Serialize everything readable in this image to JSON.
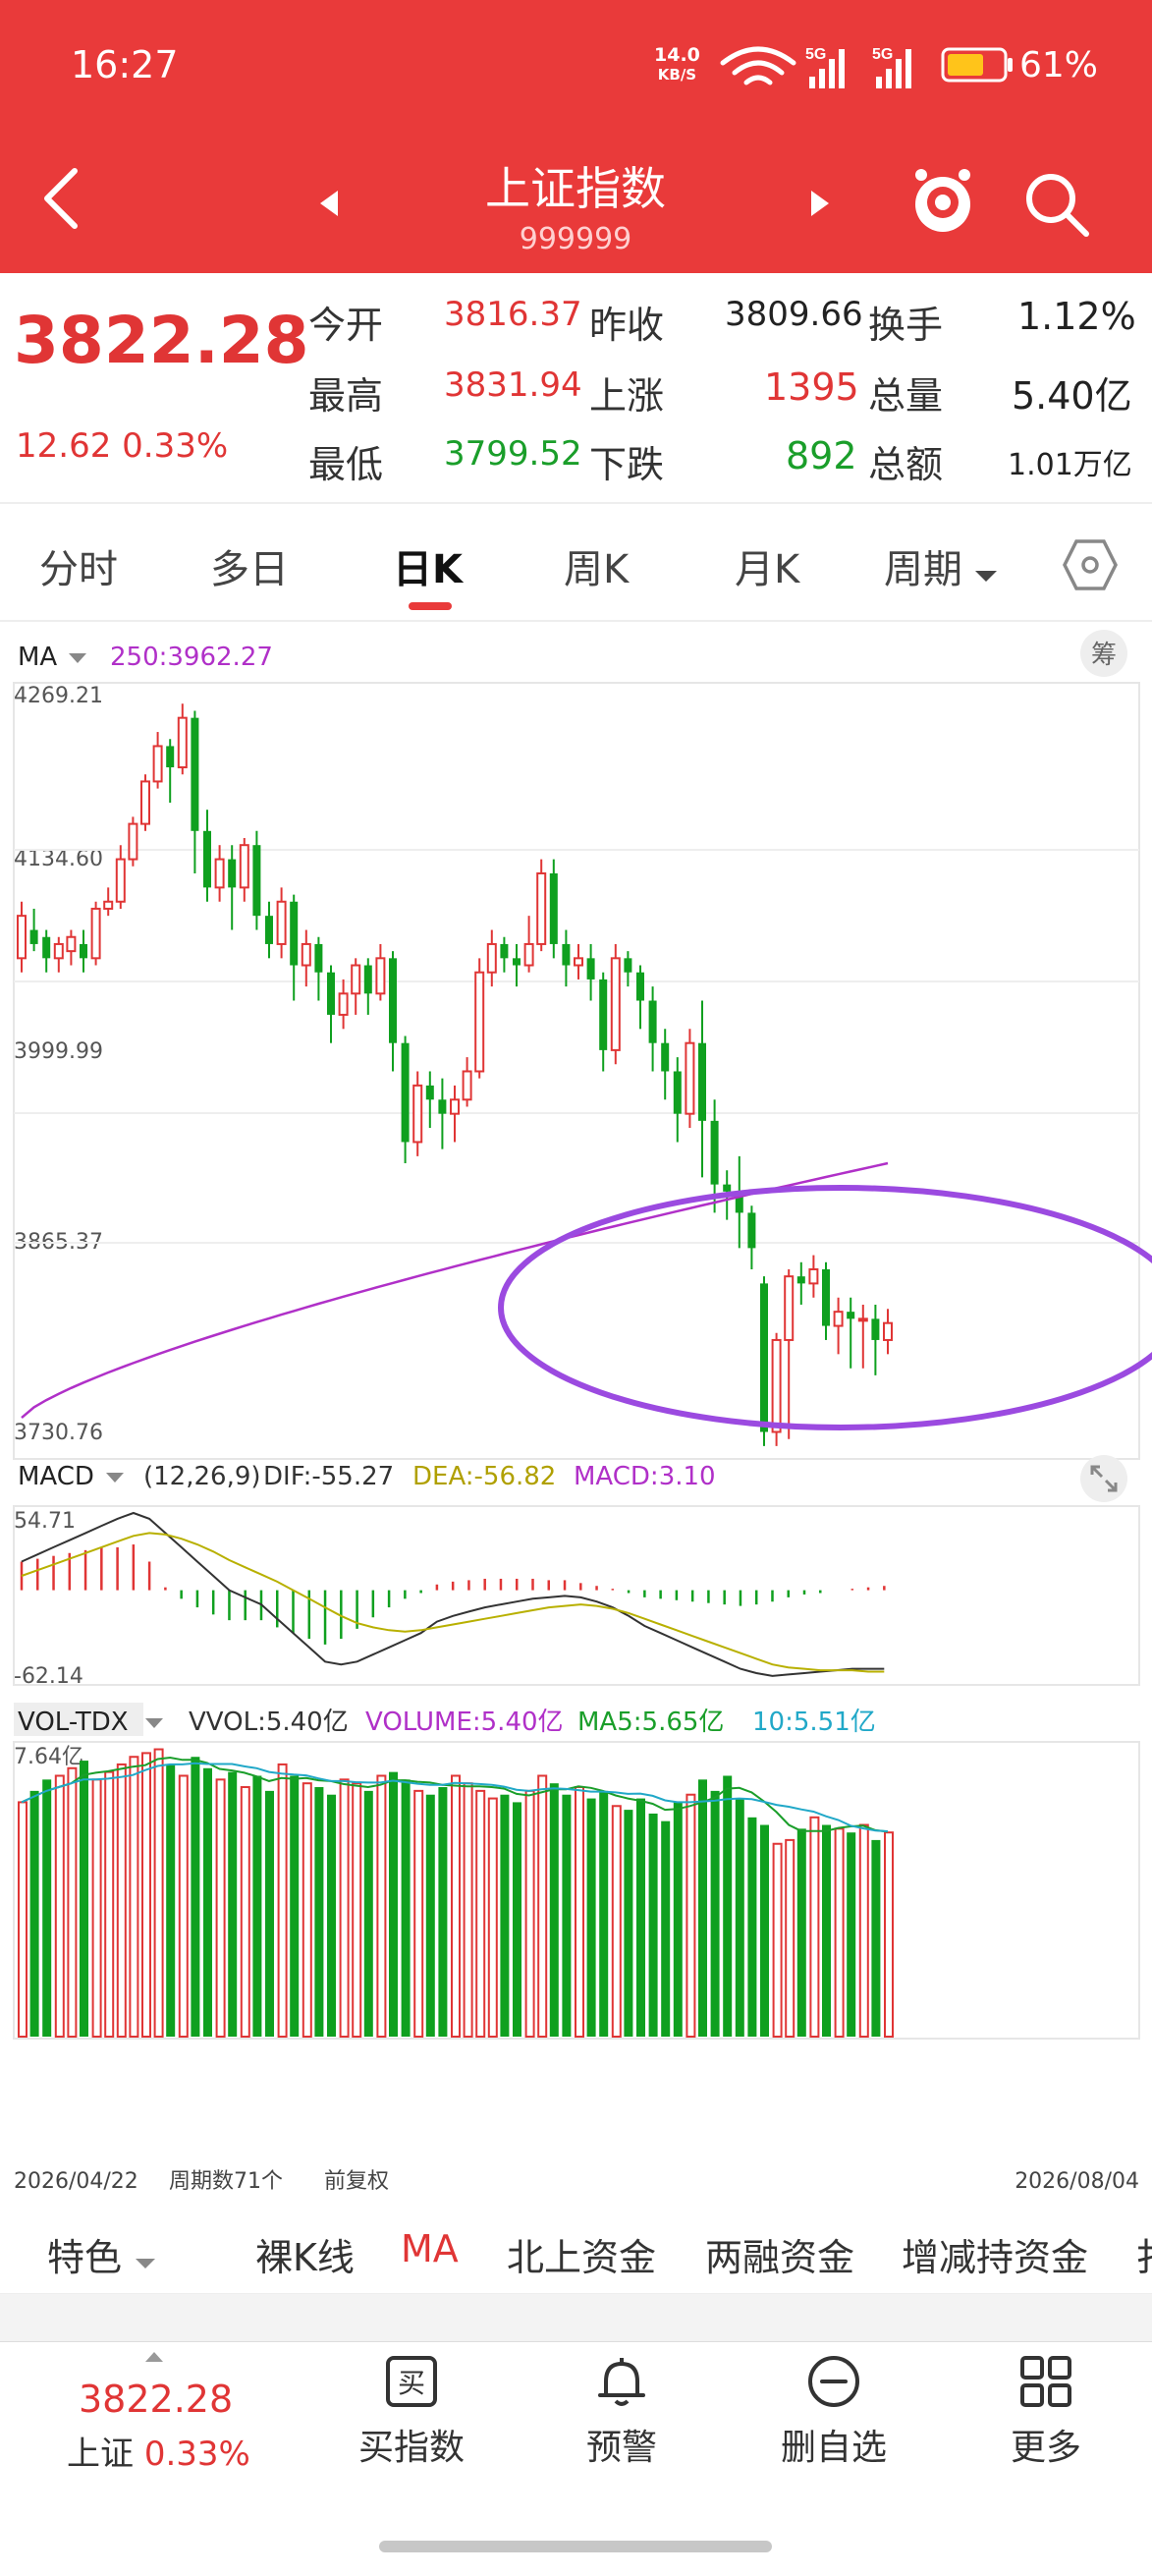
{
  "status": {
    "time": "16:27",
    "speed": "14.0",
    "speed_unit": "KB/S",
    "battery": "61%"
  },
  "header": {
    "title": "上证指数",
    "code": "999999"
  },
  "quote": {
    "price": "3822.28",
    "change": "12.62",
    "change_pct": "0.33%",
    "rows": [
      [
        {
          "label": "今开",
          "value": "3816.37",
          "color": "red"
        },
        {
          "label": "昨收",
          "value": "3809.66",
          "color": "black"
        },
        {
          "label": "换手",
          "value": "1.12%",
          "color": "black"
        }
      ],
      [
        {
          "label": "最高",
          "value": "3831.94",
          "color": "red"
        },
        {
          "label": "上涨",
          "value": "1395",
          "color": "red"
        },
        {
          "label": "总量",
          "value": "5.40亿",
          "color": "black"
        }
      ],
      [
        {
          "label": "最低",
          "value": "3799.52",
          "color": "green"
        },
        {
          "label": "下跌",
          "value": "892",
          "color": "green"
        },
        {
          "label": "总额",
          "value": "1.01万亿",
          "color": "black"
        }
      ]
    ]
  },
  "tabs": {
    "intraday": "分时",
    "multiday": "多日",
    "dayk": "日K",
    "weekk": "周K",
    "monthk": "月K",
    "period": "周期"
  },
  "main_chart": {
    "indicator": "MA",
    "ma_label": "250:3962.27",
    "chip_label": "筹",
    "y_ticks": [
      "4269.21",
      "4134.60",
      "3999.99",
      "3865.37",
      "3730.76"
    ]
  },
  "macd": {
    "indicator": "MACD",
    "params": "(12,26,9)",
    "dif": "DIF:-55.27",
    "dea": "DEA:-56.82",
    "macd": "MACD:3.10",
    "top": "54.71",
    "bottom": "-62.14"
  },
  "vol": {
    "indicator": "VOL-TDX",
    "vvol": "VVOL:5.40亿",
    "volume": "VOLUME:5.40亿",
    "ma5": "MA5:5.65亿",
    "ma10": "10:5.51亿",
    "top": "7.64亿"
  },
  "x_axis": {
    "start": "2026/04/22",
    "count": "周期数71个",
    "adjust": "前复权",
    "end": "2026/08/04"
  },
  "chart_data": {
    "type": "candlestick",
    "y_range": [
      3730.76,
      4269.21
    ],
    "ma250": {
      "name": "250",
      "start": 3755,
      "end": 3935
    },
    "candles": [
      [
        4080,
        4110,
        4120,
        4070
      ],
      [
        4100,
        4090,
        4115,
        4085
      ],
      [
        4095,
        4080,
        4100,
        4070
      ],
      [
        4080,
        4090,
        4095,
        4070
      ],
      [
        4085,
        4095,
        4100,
        4075
      ],
      [
        4090,
        4080,
        4100,
        4070
      ],
      [
        4080,
        4115,
        4120,
        4075
      ],
      [
        4115,
        4120,
        4130,
        4110
      ],
      [
        4120,
        4150,
        4160,
        4115
      ],
      [
        4150,
        4175,
        4180,
        4145
      ],
      [
        4175,
        4205,
        4210,
        4170
      ],
      [
        4205,
        4230,
        4240,
        4200
      ],
      [
        4230,
        4215,
        4235,
        4190
      ],
      [
        4215,
        4250,
        4260,
        4210
      ],
      [
        4250,
        4170,
        4255,
        4140
      ],
      [
        4170,
        4130,
        4185,
        4120
      ],
      [
        4130,
        4150,
        4160,
        4120
      ],
      [
        4150,
        4130,
        4160,
        4100
      ],
      [
        4130,
        4160,
        4165,
        4120
      ],
      [
        4160,
        4110,
        4170,
        4100
      ],
      [
        4110,
        4090,
        4120,
        4080
      ],
      [
        4090,
        4120,
        4130,
        4080
      ],
      [
        4120,
        4075,
        4125,
        4050
      ],
      [
        4075,
        4090,
        4100,
        4060
      ],
      [
        4090,
        4070,
        4095,
        4050
      ],
      [
        4070,
        4040,
        4075,
        4020
      ],
      [
        4040,
        4055,
        4065,
        4030
      ],
      [
        4055,
        4075,
        4080,
        4040
      ],
      [
        4075,
        4055,
        4080,
        4040
      ],
      [
        4055,
        4080,
        4090,
        4050
      ],
      [
        4080,
        4020,
        4085,
        4000
      ],
      [
        4020,
        3950,
        4025,
        3935
      ],
      [
        3950,
        3990,
        4000,
        3940
      ],
      [
        3990,
        3980,
        4000,
        3960
      ],
      [
        3980,
        3970,
        3995,
        3945
      ],
      [
        3970,
        3980,
        3990,
        3950
      ],
      [
        3980,
        4000,
        4010,
        3975
      ],
      [
        4000,
        4070,
        4080,
        3995
      ],
      [
        4070,
        4090,
        4100,
        4060
      ],
      [
        4090,
        4080,
        4095,
        4070
      ],
      [
        4080,
        4075,
        4090,
        4060
      ],
      [
        4075,
        4090,
        4110,
        4070
      ],
      [
        4090,
        4140,
        4150,
        4085
      ],
      [
        4140,
        4090,
        4150,
        4080
      ],
      [
        4090,
        4075,
        4100,
        4060
      ],
      [
        4075,
        4080,
        4090,
        4065
      ],
      [
        4080,
        4065,
        4090,
        4050
      ],
      [
        4065,
        4015,
        4070,
        4000
      ],
      [
        4015,
        4080,
        4090,
        4005
      ],
      [
        4080,
        4070,
        4085,
        4060
      ],
      [
        4070,
        4050,
        4075,
        4030
      ],
      [
        4050,
        4020,
        4060,
        4000
      ],
      [
        4020,
        4000,
        4030,
        3980
      ],
      [
        4000,
        3970,
        4010,
        3950
      ],
      [
        3970,
        4020,
        4030,
        3960
      ],
      [
        4020,
        3965,
        4050,
        3925
      ],
      [
        3965,
        3920,
        3980,
        3900
      ],
      [
        3920,
        3915,
        3930,
        3895
      ],
      [
        3915,
        3900,
        3940,
        3875
      ],
      [
        3900,
        3875,
        3905,
        3860
      ],
      [
        3850,
        3745,
        3855,
        3735
      ],
      [
        3745,
        3810,
        3815,
        3735
      ],
      [
        3810,
        3855,
        3860,
        3740
      ],
      [
        3855,
        3850,
        3865,
        3835
      ],
      [
        3850,
        3860,
        3870,
        3840
      ],
      [
        3860,
        3820,
        3865,
        3810
      ],
      [
        3820,
        3830,
        3840,
        3800
      ],
      [
        3830,
        3825,
        3840,
        3790
      ],
      [
        3825,
        3825,
        3835,
        3790
      ],
      [
        3825,
        3810,
        3835,
        3785
      ],
      [
        3810,
        3822,
        3832,
        3800
      ]
    ],
    "macd_range": [
      -62.14,
      54.71
    ],
    "dif": [
      20,
      25,
      30,
      35,
      40,
      45,
      50,
      54,
      50,
      40,
      30,
      20,
      10,
      0,
      -5,
      -10,
      -20,
      -30,
      -40,
      -50,
      -52,
      -50,
      -45,
      -40,
      -35,
      -30,
      -22,
      -18,
      -15,
      -12,
      -10,
      -8,
      -6,
      -5,
      -4,
      -5,
      -8,
      -12,
      -18,
      -25,
      -30,
      -35,
      -40,
      -45,
      -50,
      -55,
      -58,
      -60,
      -59,
      -58,
      -57,
      -56,
      -55,
      -55,
      -55
    ],
    "dea": [
      10,
      14,
      18,
      22,
      26,
      30,
      34,
      38,
      40,
      39,
      36,
      32,
      27,
      21,
      16,
      11,
      6,
      0,
      -6,
      -12,
      -18,
      -23,
      -26,
      -28,
      -29,
      -28,
      -26,
      -24,
      -22,
      -20,
      -18,
      -16,
      -14,
      -12,
      -11,
      -10,
      -11,
      -13,
      -16,
      -20,
      -24,
      -28,
      -32,
      -36,
      -40,
      -44,
      -48,
      -52,
      -54,
      -55,
      -56,
      -56,
      -56,
      -57,
      -57
    ],
    "macd_hist": [
      20,
      22,
      24,
      26,
      28,
      30,
      30,
      32,
      20,
      2,
      -6,
      -12,
      -17,
      -21,
      -21,
      -21,
      -26,
      -30,
      -34,
      -38,
      -34,
      -27,
      -19,
      -12,
      -6,
      -2,
      4,
      6,
      7,
      8,
      8,
      8,
      8,
      7,
      7,
      5,
      3,
      1,
      -2,
      -5,
      -6,
      -7,
      -8,
      -9,
      -10,
      -11,
      -10,
      -8,
      -5,
      -3,
      -2,
      0,
      1,
      2,
      3
    ],
    "volume_max": 7.64,
    "volumes": [
      6.2,
      6.5,
      6.8,
      6.9,
      7.1,
      7.3,
      6.8,
      7.0,
      7.2,
      7.4,
      7.5,
      7.6,
      7.2,
      6.9,
      7.4,
      7.1,
      6.8,
      7.0,
      6.6,
      6.9,
      6.5,
      7.2,
      6.9,
      6.7,
      6.6,
      6.4,
      6.8,
      6.7,
      6.5,
      6.9,
      7.0,
      6.8,
      6.5,
      6.4,
      6.6,
      6.9,
      6.7,
      6.5,
      6.3,
      6.4,
      6.2,
      6.5,
      6.9,
      6.7,
      6.4,
      6.6,
      6.3,
      6.5,
      6.1,
      6.0,
      6.3,
      5.9,
      5.7,
      6.2,
      6.4,
      6.8,
      6.5,
      6.9,
      6.3,
      5.8,
      5.6,
      5.1,
      5.2,
      5.5,
      5.8,
      5.6,
      5.5,
      5.4,
      5.6,
      5.2,
      5.4
    ]
  },
  "bottom_tabs": {
    "feature": "特色",
    "naked": "裸K线",
    "ma": "MA",
    "north": "北上资金",
    "margin": "两融资金",
    "holder": "增减持资金",
    "more": "扌"
  },
  "footer": {
    "price": "3822.28",
    "name": "上证",
    "change": "0.33%",
    "buy": "买指数",
    "alert": "预警",
    "delete": "删自选",
    "more": "更多",
    "buy_icon_char": "买"
  }
}
